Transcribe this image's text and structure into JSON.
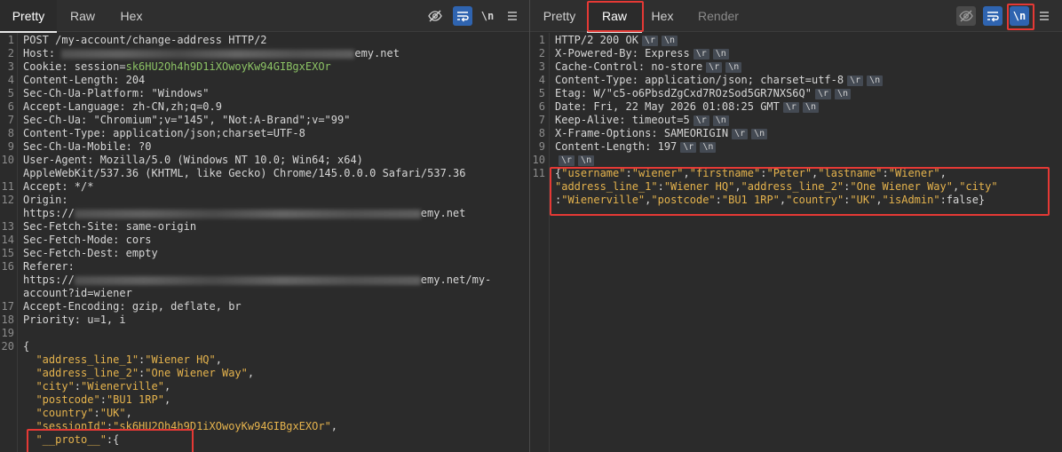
{
  "request": {
    "tabs": [
      "Pretty",
      "Raw",
      "Hex"
    ],
    "active_tab": "Pretty",
    "toolbar": {
      "newline_label": "\\n"
    },
    "lines": [
      {
        "n": "1",
        "parts": [
          {
            "t": "POST /my-account/change-address HTTP/2",
            "c": "k"
          }
        ]
      },
      {
        "n": "2",
        "parts": [
          {
            "t": "Host: ",
            "c": "k"
          },
          {
            "blur": 330
          },
          {
            "t": "emy.net",
            "c": "k"
          }
        ]
      },
      {
        "n": "3",
        "parts": [
          {
            "t": "Cookie: session=",
            "c": "k"
          },
          {
            "t": "sk6HU2Oh4h9D1iXOwoyKw94GIBgxEXOr",
            "c": "v-green"
          }
        ]
      },
      {
        "n": "4",
        "parts": [
          {
            "t": "Content-Length: 204",
            "c": "k"
          }
        ]
      },
      {
        "n": "5",
        "parts": [
          {
            "t": "Sec-Ch-Ua-Platform: \"Windows\"",
            "c": "k"
          }
        ]
      },
      {
        "n": "6",
        "parts": [
          {
            "t": "Accept-Language: zh-CN,zh;q=0.9",
            "c": "k"
          }
        ]
      },
      {
        "n": "7",
        "parts": [
          {
            "t": "Sec-Ch-Ua: \"Chromium\";v=\"145\", \"Not:A-Brand\";v=\"99\"",
            "c": "k"
          }
        ]
      },
      {
        "n": "8",
        "parts": [
          {
            "t": "Content-Type: application/json;charset=UTF-8",
            "c": "k"
          }
        ]
      },
      {
        "n": "9",
        "parts": [
          {
            "t": "Sec-Ch-Ua-Mobile: ?0",
            "c": "k"
          }
        ]
      },
      {
        "n": "10",
        "parts": [
          {
            "t": "User-Agent: Mozilla/5.0 (Windows NT 10.0; Win64; x64)",
            "c": "k"
          }
        ]
      },
      {
        "n": "",
        "parts": [
          {
            "t": "AppleWebKit/537.36 (KHTML, like Gecko) Chrome/145.0.0.0 Safari/537.36",
            "c": "k"
          }
        ]
      },
      {
        "n": "11",
        "parts": [
          {
            "t": "Accept: */*",
            "c": "k"
          }
        ]
      },
      {
        "n": "12",
        "parts": [
          {
            "t": "Origin:",
            "c": "k"
          }
        ]
      },
      {
        "n": "",
        "parts": [
          {
            "t": "https://",
            "c": "k"
          },
          {
            "blur": 390
          },
          {
            "t": "emy.net",
            "c": "k"
          }
        ]
      },
      {
        "n": "13",
        "parts": [
          {
            "t": "Sec-Fetch-Site: same-origin",
            "c": "k"
          }
        ]
      },
      {
        "n": "14",
        "parts": [
          {
            "t": "Sec-Fetch-Mode: cors",
            "c": "k"
          }
        ]
      },
      {
        "n": "15",
        "parts": [
          {
            "t": "Sec-Fetch-Dest: empty",
            "c": "k"
          }
        ]
      },
      {
        "n": "16",
        "parts": [
          {
            "t": "Referer:",
            "c": "k"
          }
        ]
      },
      {
        "n": "",
        "parts": [
          {
            "t": "https://",
            "c": "k"
          },
          {
            "blur": 390
          },
          {
            "t": "emy.net/my-",
            "c": "k"
          }
        ]
      },
      {
        "n": "",
        "parts": [
          {
            "t": "account?id=wiener",
            "c": "k"
          }
        ]
      },
      {
        "n": "17",
        "parts": [
          {
            "t": "Accept-Encoding: gzip, deflate, br",
            "c": "k"
          }
        ]
      },
      {
        "n": "18",
        "parts": [
          {
            "t": "Priority: u=1, i",
            "c": "k"
          }
        ]
      },
      {
        "n": "19",
        "parts": []
      },
      {
        "n": "20",
        "parts": [
          {
            "t": "{",
            "c": "v-punct"
          }
        ]
      },
      {
        "n": "",
        "parts": [
          {
            "t": "  \"address_line_1\"",
            "c": "v-key"
          },
          {
            "t": ":",
            "c": "v-punct"
          },
          {
            "t": "\"Wiener HQ\"",
            "c": "v-str"
          },
          {
            "t": ",",
            "c": "v-punct"
          }
        ]
      },
      {
        "n": "",
        "parts": [
          {
            "t": "  \"address_line_2\"",
            "c": "v-key"
          },
          {
            "t": ":",
            "c": "v-punct"
          },
          {
            "t": "\"One Wiener Way\"",
            "c": "v-str"
          },
          {
            "t": ",",
            "c": "v-punct"
          }
        ]
      },
      {
        "n": "",
        "parts": [
          {
            "t": "  \"city\"",
            "c": "v-key"
          },
          {
            "t": ":",
            "c": "v-punct"
          },
          {
            "t": "\"Wienerville\"",
            "c": "v-str"
          },
          {
            "t": ",",
            "c": "v-punct"
          }
        ]
      },
      {
        "n": "",
        "parts": [
          {
            "t": "  \"postcode\"",
            "c": "v-key"
          },
          {
            "t": ":",
            "c": "v-punct"
          },
          {
            "t": "\"BU1 1RP\"",
            "c": "v-str"
          },
          {
            "t": ",",
            "c": "v-punct"
          }
        ]
      },
      {
        "n": "",
        "parts": [
          {
            "t": "  \"country\"",
            "c": "v-key"
          },
          {
            "t": ":",
            "c": "v-punct"
          },
          {
            "t": "\"UK\"",
            "c": "v-str"
          },
          {
            "t": ",",
            "c": "v-punct"
          }
        ]
      },
      {
        "n": "",
        "parts": [
          {
            "t": "  \"sessionId\"",
            "c": "v-key"
          },
          {
            "t": ":",
            "c": "v-punct"
          },
          {
            "t": "\"sk6HU2Oh4h9D1iXOwoyKw94GIBgxEXOr\"",
            "c": "v-str"
          },
          {
            "t": ",",
            "c": "v-punct"
          }
        ]
      },
      {
        "n": "",
        "parts": [
          {
            "t": "  \"__proto__\"",
            "c": "v-key"
          },
          {
            "t": ":{",
            "c": "v-punct"
          }
        ]
      }
    ]
  },
  "response": {
    "tabs": [
      "Pretty",
      "Raw",
      "Hex",
      "Render"
    ],
    "active_tab": "Raw",
    "toolbar": {
      "newline_label": "\\n"
    },
    "crlf": [
      "\\r",
      "\\n"
    ],
    "lines": [
      {
        "n": "1",
        "parts": [
          {
            "t": "HTTP/2 200 OK",
            "c": "k"
          }
        ],
        "crlf": true
      },
      {
        "n": "2",
        "parts": [
          {
            "t": "X-Powered-By: Express",
            "c": "k"
          }
        ],
        "crlf": true
      },
      {
        "n": "3",
        "parts": [
          {
            "t": "Cache-Control: no-store",
            "c": "k"
          }
        ],
        "crlf": true
      },
      {
        "n": "4",
        "parts": [
          {
            "t": "Content-Type: application/json; charset=utf-8",
            "c": "k"
          }
        ],
        "crlf": true
      },
      {
        "n": "5",
        "parts": [
          {
            "t": "Etag: W/\"c5-o6PbsdZgCxd7ROzSod5GR7NXS6Q\"",
            "c": "k"
          }
        ],
        "crlf": true
      },
      {
        "n": "6",
        "parts": [
          {
            "t": "Date: Fri, 22 May 2026 01:08:25 GMT",
            "c": "k"
          }
        ],
        "crlf": true
      },
      {
        "n": "7",
        "parts": [
          {
            "t": "Keep-Alive: timeout=5",
            "c": "k"
          }
        ],
        "crlf": true
      },
      {
        "n": "8",
        "parts": [
          {
            "t": "X-Frame-Options: SAMEORIGIN",
            "c": "k"
          }
        ],
        "crlf": true
      },
      {
        "n": "9",
        "parts": [
          {
            "t": "Content-Length: 197",
            "c": "k"
          }
        ],
        "crlf": true
      },
      {
        "n": "10",
        "parts": [],
        "crlf": true
      },
      {
        "n": "11",
        "parts": [
          {
            "t": "{",
            "c": "v-punct"
          },
          {
            "t": "\"username\"",
            "c": "v-key"
          },
          {
            "t": ":",
            "c": "v-punct"
          },
          {
            "t": "\"wiener\"",
            "c": "v-str"
          },
          {
            "t": ",",
            "c": "v-punct"
          },
          {
            "t": "\"firstname\"",
            "c": "v-key"
          },
          {
            "t": ":",
            "c": "v-punct"
          },
          {
            "t": "\"Peter\"",
            "c": "v-str"
          },
          {
            "t": ",",
            "c": "v-punct"
          },
          {
            "t": "\"lastname\"",
            "c": "v-key"
          },
          {
            "t": ":",
            "c": "v-punct"
          },
          {
            "t": "\"Wiener\"",
            "c": "v-str"
          },
          {
            "t": ",",
            "c": "v-punct"
          }
        ]
      },
      {
        "n": "",
        "parts": [
          {
            "t": "\"address_line_1\"",
            "c": "v-key"
          },
          {
            "t": ":",
            "c": "v-punct"
          },
          {
            "t": "\"Wiener HQ\"",
            "c": "v-str"
          },
          {
            "t": ",",
            "c": "v-punct"
          },
          {
            "t": "\"address_line_2\"",
            "c": "v-key"
          },
          {
            "t": ":",
            "c": "v-punct"
          },
          {
            "t": "\"One Wiener Way\"",
            "c": "v-str"
          },
          {
            "t": ",",
            "c": "v-punct"
          },
          {
            "t": "\"city\"",
            "c": "v-key"
          }
        ]
      },
      {
        "n": "",
        "parts": [
          {
            "t": ":",
            "c": "v-punct"
          },
          {
            "t": "\"Wienerville\"",
            "c": "v-str"
          },
          {
            "t": ",",
            "c": "v-punct"
          },
          {
            "t": "\"postcode\"",
            "c": "v-key"
          },
          {
            "t": ":",
            "c": "v-punct"
          },
          {
            "t": "\"BU1 1RP\"",
            "c": "v-str"
          },
          {
            "t": ",",
            "c": "v-punct"
          },
          {
            "t": "\"country\"",
            "c": "v-key"
          },
          {
            "t": ":",
            "c": "v-punct"
          },
          {
            "t": "\"UK\"",
            "c": "v-str"
          },
          {
            "t": ",",
            "c": "v-punct"
          },
          {
            "t": "\"isAdmin\"",
            "c": "v-key"
          },
          {
            "t": ":false}",
            "c": "v-punct"
          }
        ]
      }
    ]
  },
  "colors": {
    "highlight": "#e53935",
    "button_active": "#2f64b0",
    "json_key": "#e5b34d",
    "cookie_value": "#8cc265"
  },
  "icons": {
    "request_toolbar": [
      "eye-slash-icon",
      "wrap-lines-icon",
      "newline-icon",
      "menu-icon"
    ],
    "response_toolbar": [
      "eye-slash-icon",
      "wrap-lines-icon",
      "newline-icon",
      "menu-icon"
    ]
  }
}
